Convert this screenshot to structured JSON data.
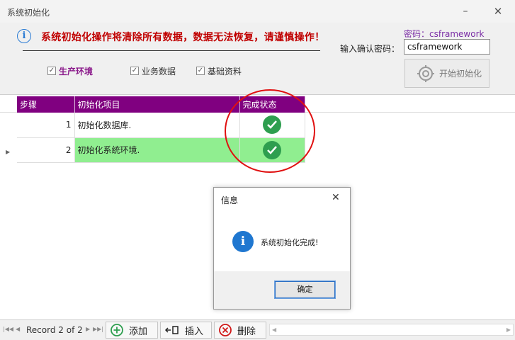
{
  "window": {
    "title": "系统初始化",
    "minimize_glyph": "–",
    "close_glyph": "✕"
  },
  "warning": {
    "icon": "info-icon",
    "text": "系统初始化操作将清除所有数据，数据无法恢复，请谨慎操作！"
  },
  "password": {
    "hint": "密码：csframework",
    "label": "输入确认密码：",
    "value": "csframework"
  },
  "options": [
    {
      "label": "生产环境",
      "checked": true
    },
    {
      "label": "业务数据",
      "checked": true
    },
    {
      "label": "基础资料",
      "checked": true
    }
  ],
  "init_button": {
    "label": "开始初始化",
    "icon": "gear-icon"
  },
  "grid": {
    "columns": [
      "步骤",
      "初始化项目",
      "完成状态"
    ],
    "rows": [
      {
        "step": "1",
        "item": "初始化数据库.",
        "status": "done"
      },
      {
        "step": "2",
        "item": "初始化系统环境.",
        "status": "done"
      }
    ],
    "selected_row": 1
  },
  "dialog": {
    "title": "信息",
    "message": "系统初始化完成!",
    "ok_label": "确定",
    "close_glyph": "✕"
  },
  "navigator": {
    "record_text": "Record 2 of 2",
    "add_label": "添加",
    "insert_label": "插入",
    "delete_label": "删除"
  },
  "colors": {
    "header_bg": "#800080",
    "selected_row": "#90ee90",
    "warning_text": "#c00000",
    "check_green": "#2e9e4f",
    "highlight_ellipse": "#e01010"
  }
}
